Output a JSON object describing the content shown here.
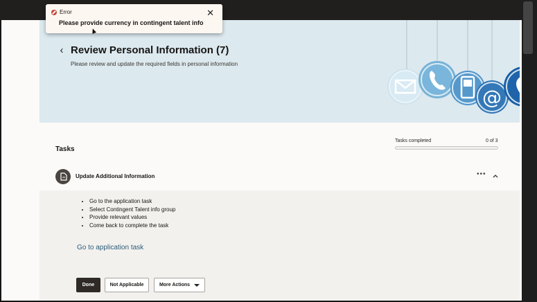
{
  "toast": {
    "title": "Error",
    "message": "Please provide currency in contingent talent info",
    "icons": {
      "status": "error-icon",
      "close": "close-icon"
    },
    "accent": "#c74634"
  },
  "header": {
    "back_icon": "chevron-left-icon",
    "title": "Review Personal Information (7)",
    "subtitle": "Please review and update the required fields in personal information",
    "graphic_icons": [
      "mail-icon",
      "phone-icon",
      "mobile-icon",
      "at-sign-icon",
      "location-pin-icon"
    ]
  },
  "tasks": {
    "heading": "Tasks",
    "progress_label": "Tasks completed",
    "progress_count": "0 of 3",
    "progress_fraction": 0
  },
  "task": {
    "title": "Update Additional Information",
    "more_label": "•••",
    "steps": [
      "Go to the application task",
      "Select Contingent Talent info group",
      "Provide relevant values",
      "Come back to complete the task"
    ],
    "link": "Go to application task",
    "buttons": {
      "done": "Done",
      "not_applicable": "Not Applicable",
      "more_actions": "More Actions"
    }
  }
}
